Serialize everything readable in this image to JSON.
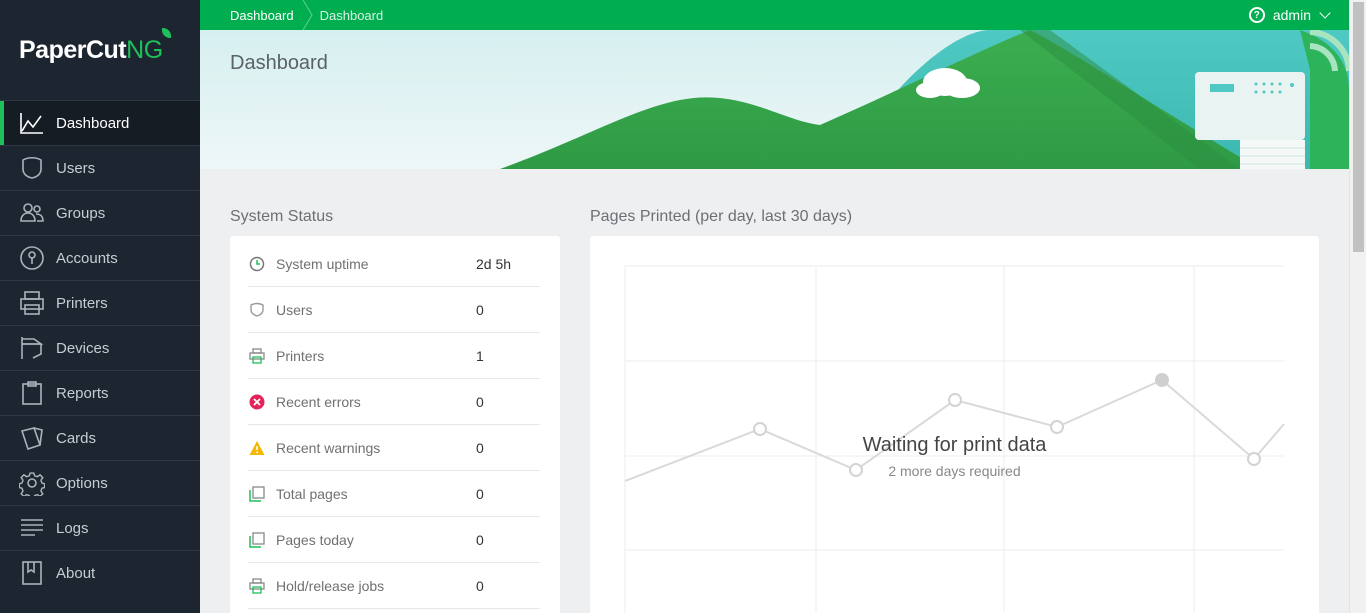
{
  "app": {
    "logo_main": "PaperCut",
    "logo_suffix": "NG"
  },
  "topbar": {
    "breadcrumbs": [
      "Dashboard",
      "Dashboard"
    ],
    "user": "admin",
    "help_icon": "question-circle-icon"
  },
  "sidebar": {
    "items": [
      {
        "label": "Dashboard",
        "icon": "line-chart-icon",
        "active": true
      },
      {
        "label": "Users",
        "icon": "user-shield-icon"
      },
      {
        "label": "Groups",
        "icon": "group-icon"
      },
      {
        "label": "Accounts",
        "icon": "account-lock-icon"
      },
      {
        "label": "Printers",
        "icon": "printer-icon"
      },
      {
        "label": "Devices",
        "icon": "device-icon"
      },
      {
        "label": "Reports",
        "icon": "clipboard-icon"
      },
      {
        "label": "Cards",
        "icon": "cards-icon"
      },
      {
        "label": "Options",
        "icon": "gear-icon"
      },
      {
        "label": "Logs",
        "icon": "lines-icon"
      },
      {
        "label": "About",
        "icon": "book-icon"
      }
    ]
  },
  "page": {
    "title": "Dashboard"
  },
  "status": {
    "title": "System Status",
    "rows": [
      {
        "label": "System uptime",
        "value": "2d 5h",
        "icon": "clock-icon"
      },
      {
        "label": "Users",
        "value": "0",
        "icon": "user-shield-icon"
      },
      {
        "label": "Printers",
        "value": "1",
        "icon": "printer-icon"
      },
      {
        "label": "Recent errors",
        "value": "0",
        "icon": "error-icon"
      },
      {
        "label": "Recent warnings",
        "value": "0",
        "icon": "warning-icon"
      },
      {
        "label": "Total pages",
        "value": "0",
        "icon": "pages-icon"
      },
      {
        "label": "Pages today",
        "value": "0",
        "icon": "pages-icon"
      },
      {
        "label": "Hold/release jobs",
        "value": "0",
        "icon": "printer-icon"
      }
    ]
  },
  "chart": {
    "title": "Pages Printed (per day, last 30 days)",
    "wait_title": "Waiting for print data",
    "wait_subtitle": "2 more days required"
  },
  "colors": {
    "brand_green": "#00ad4f",
    "sidebar_bg": "#1d2630",
    "accent_green": "#1fbf5a"
  }
}
